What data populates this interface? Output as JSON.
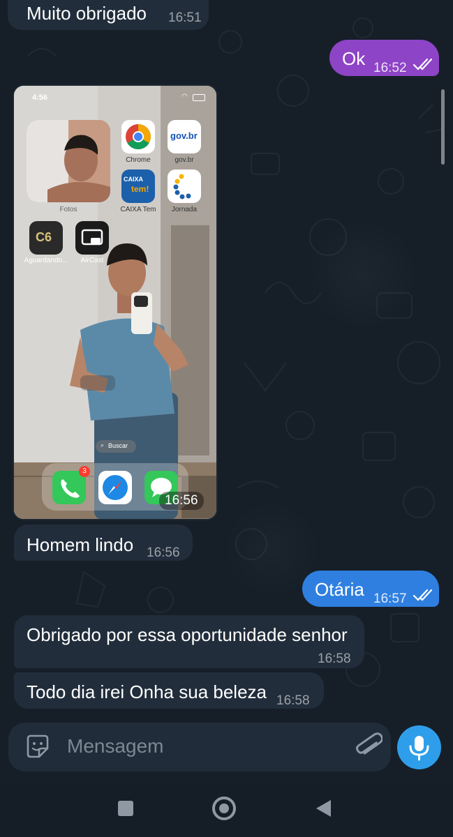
{
  "messages": [
    {
      "dir": "in",
      "text": "Muito obrigado",
      "time": "16:51"
    },
    {
      "dir": "out",
      "text": "Ok",
      "time": "16:52"
    },
    {
      "dir": "in",
      "type": "photo",
      "time": "16:56"
    },
    {
      "dir": "in",
      "text": "Homem lindo",
      "time": "16:56"
    },
    {
      "dir": "out",
      "text": "Otária",
      "time": "16:57"
    },
    {
      "dir": "in",
      "text": "Obrigado por essa oportunidade senhor",
      "time": "16:58"
    },
    {
      "dir": "in",
      "text": "Todo dia irei Onha sua beleza",
      "time": "16:58"
    }
  ],
  "photo": {
    "status_time": "4:56",
    "apps": {
      "fotos": "Fotos",
      "chrome": "Chrome",
      "govbr": "gov.br",
      "govbr_logo": "gov.br",
      "caixa": "CAIXA Tem",
      "caixa_logo_1": "CAIXA",
      "caixa_logo_2": "tem!",
      "jornada": "Jornada",
      "c6": "Aguardando...",
      "c6_logo": "C6",
      "aircast": "AirCast"
    },
    "search_label": "Buscar",
    "phone_badge": "3"
  },
  "input": {
    "placeholder": "Mensagem"
  },
  "colors": {
    "outgoing_bubble_1": "#8e44c6",
    "outgoing_bubble_2": "#2f7fe0",
    "incoming_bubble": "#212d3b",
    "mic_button": "#2f9eea"
  }
}
